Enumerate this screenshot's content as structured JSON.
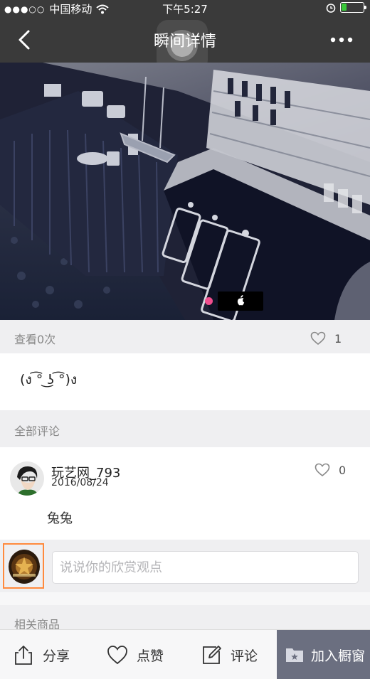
{
  "status_bar": {
    "signal_dots": "●●●○○",
    "carrier": "中国移动",
    "time": "下午5:27",
    "battery_level": 0.22,
    "icons": [
      "wifi-icon",
      "alarm-icon",
      "battery-icon"
    ]
  },
  "nav": {
    "title": "瞬间详情",
    "back_icon": "back-chevron-icon",
    "more_icon": "more-dots-icon"
  },
  "gallery": {
    "page_count": 2,
    "active_index": 0,
    "indicator_colors": {
      "active": "#f04d8d"
    }
  },
  "stats": {
    "views_label": "查看0次",
    "like_count": "1"
  },
  "post": {
    "text": "(ง ͡° ͜ʖ ͡°)ง"
  },
  "comments": {
    "header": "全部评论",
    "items": [
      {
        "username": "玩艺网_793",
        "date": "2016/08/24",
        "like_count": "0",
        "text": "兔兔"
      }
    ]
  },
  "comment_input": {
    "placeholder": "说说你的欣赏观点"
  },
  "related": {
    "header": "相关商品"
  },
  "bottom_bar": {
    "share_label": "分享",
    "like_label": "点赞",
    "comment_label": "评论",
    "add_to_showcase_label": "加入橱窗"
  },
  "colors": {
    "nav_bg": "#3a3a3a",
    "accent_pink": "#f04d8d",
    "selection_outline": "#ff8a3d",
    "cart_button_bg": "#6b6f80"
  }
}
